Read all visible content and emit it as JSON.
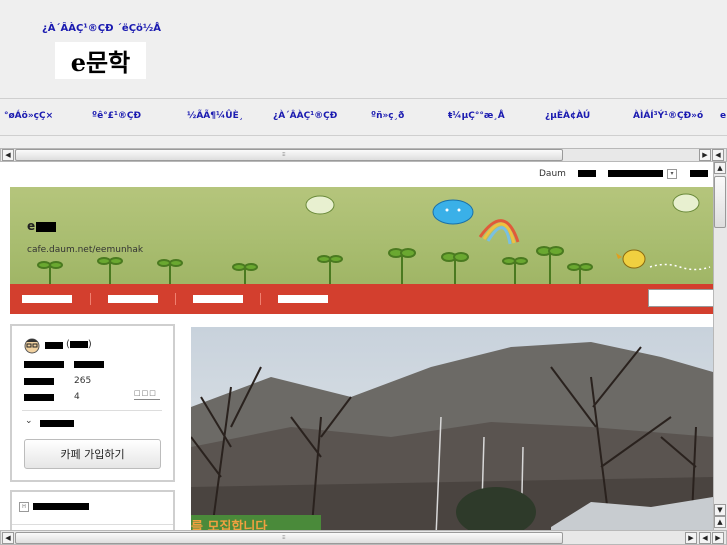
{
  "header": {
    "title": "¿À´ÂÀÇ¹®ÇÐ ´ëÇö½Å",
    "logo_text": "e문학"
  },
  "nav": {
    "items": [
      "°øÁö»çÇ×",
      "ºê°£¹®ÇÐ",
      "½ÃÃ¶¼ÛÈ¸",
      "¿À´ÂÀÇ¹®ÇÐ",
      "ºñ»ç¸ð",
      "ŧ¼µÇ°°æ¸Å",
      "¿µÈÀ¢ÀÚ",
      "ÀÌÁÍ³Ý¹®ÇÐ»ó",
      "e"
    ]
  },
  "cafe": {
    "util_daum": "Daum",
    "name_prefix": "e",
    "url": "cafe.daum.net/eemunhak"
  },
  "profile": {
    "members_count": "265",
    "visits_count": "4",
    "join_label": "카페 가입하기"
  },
  "photo_banner_text": "를 모집합니다",
  "colors": {
    "menu_bar": "#d33f2e",
    "nav_text": "#1a1ab0",
    "banner_green": "#a9bd70"
  }
}
